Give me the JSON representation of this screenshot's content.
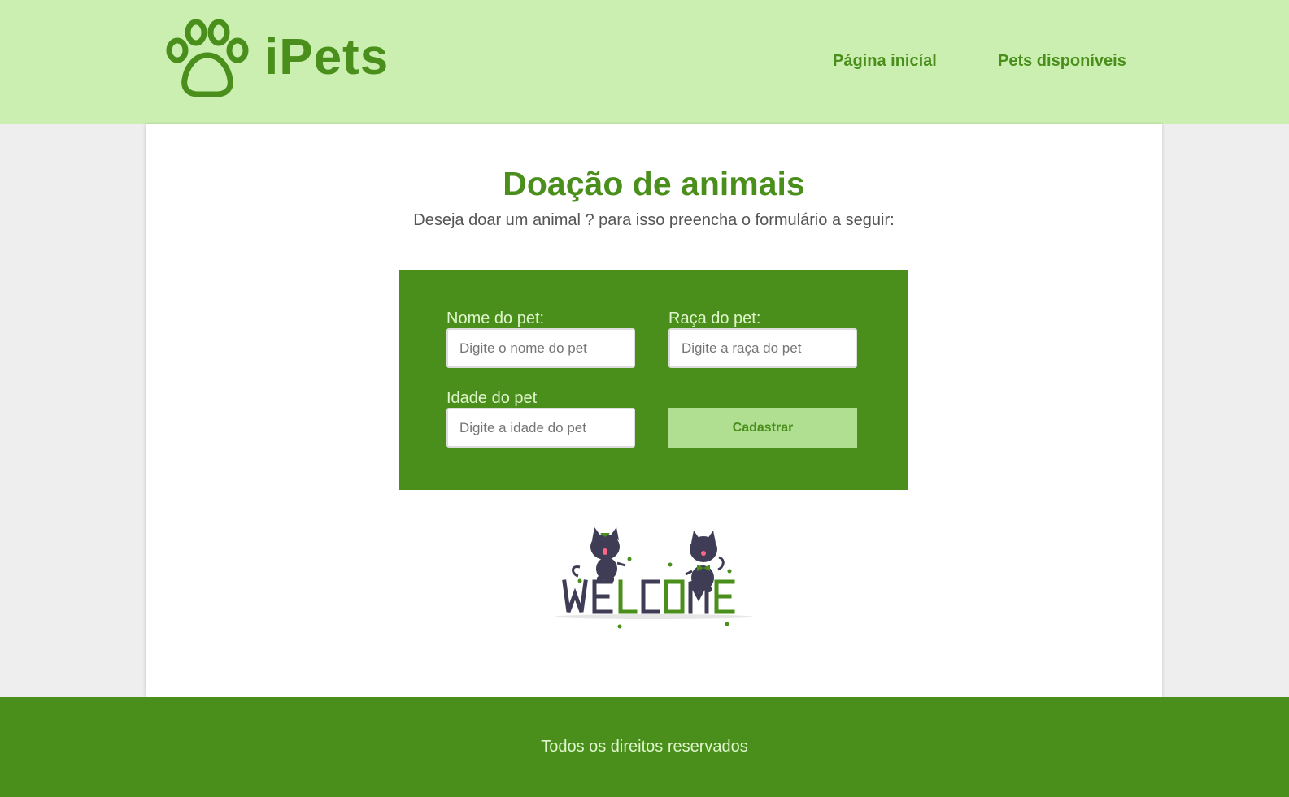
{
  "header": {
    "logo_text": "iPets",
    "nav": {
      "home": "Página inicíal",
      "pets": "Pets disponíveis"
    }
  },
  "main": {
    "title": "Doação de animais",
    "subtitle": "Deseja doar um animal ? para isso preencha o formulário a seguir:"
  },
  "form": {
    "name_label": "Nome do pet:",
    "name_placeholder": "Digite o nome do pet",
    "breed_label": "Raça do pet:",
    "breed_placeholder": "Digite a raça do pet",
    "age_label": "Idade do pet",
    "age_placeholder": "Digite a idade do pet",
    "submit_label": "Cadastrar"
  },
  "illustration": {
    "letters": [
      "W",
      "E",
      "L",
      "C",
      "O",
      "M",
      "E"
    ]
  },
  "footer": {
    "text": "Todos os direitos reservados"
  },
  "colors": {
    "brand_green": "#4a8f1b",
    "header_bg": "#cbefb0",
    "button_bg": "#b0df92",
    "cat_body": "#3f3d56"
  }
}
